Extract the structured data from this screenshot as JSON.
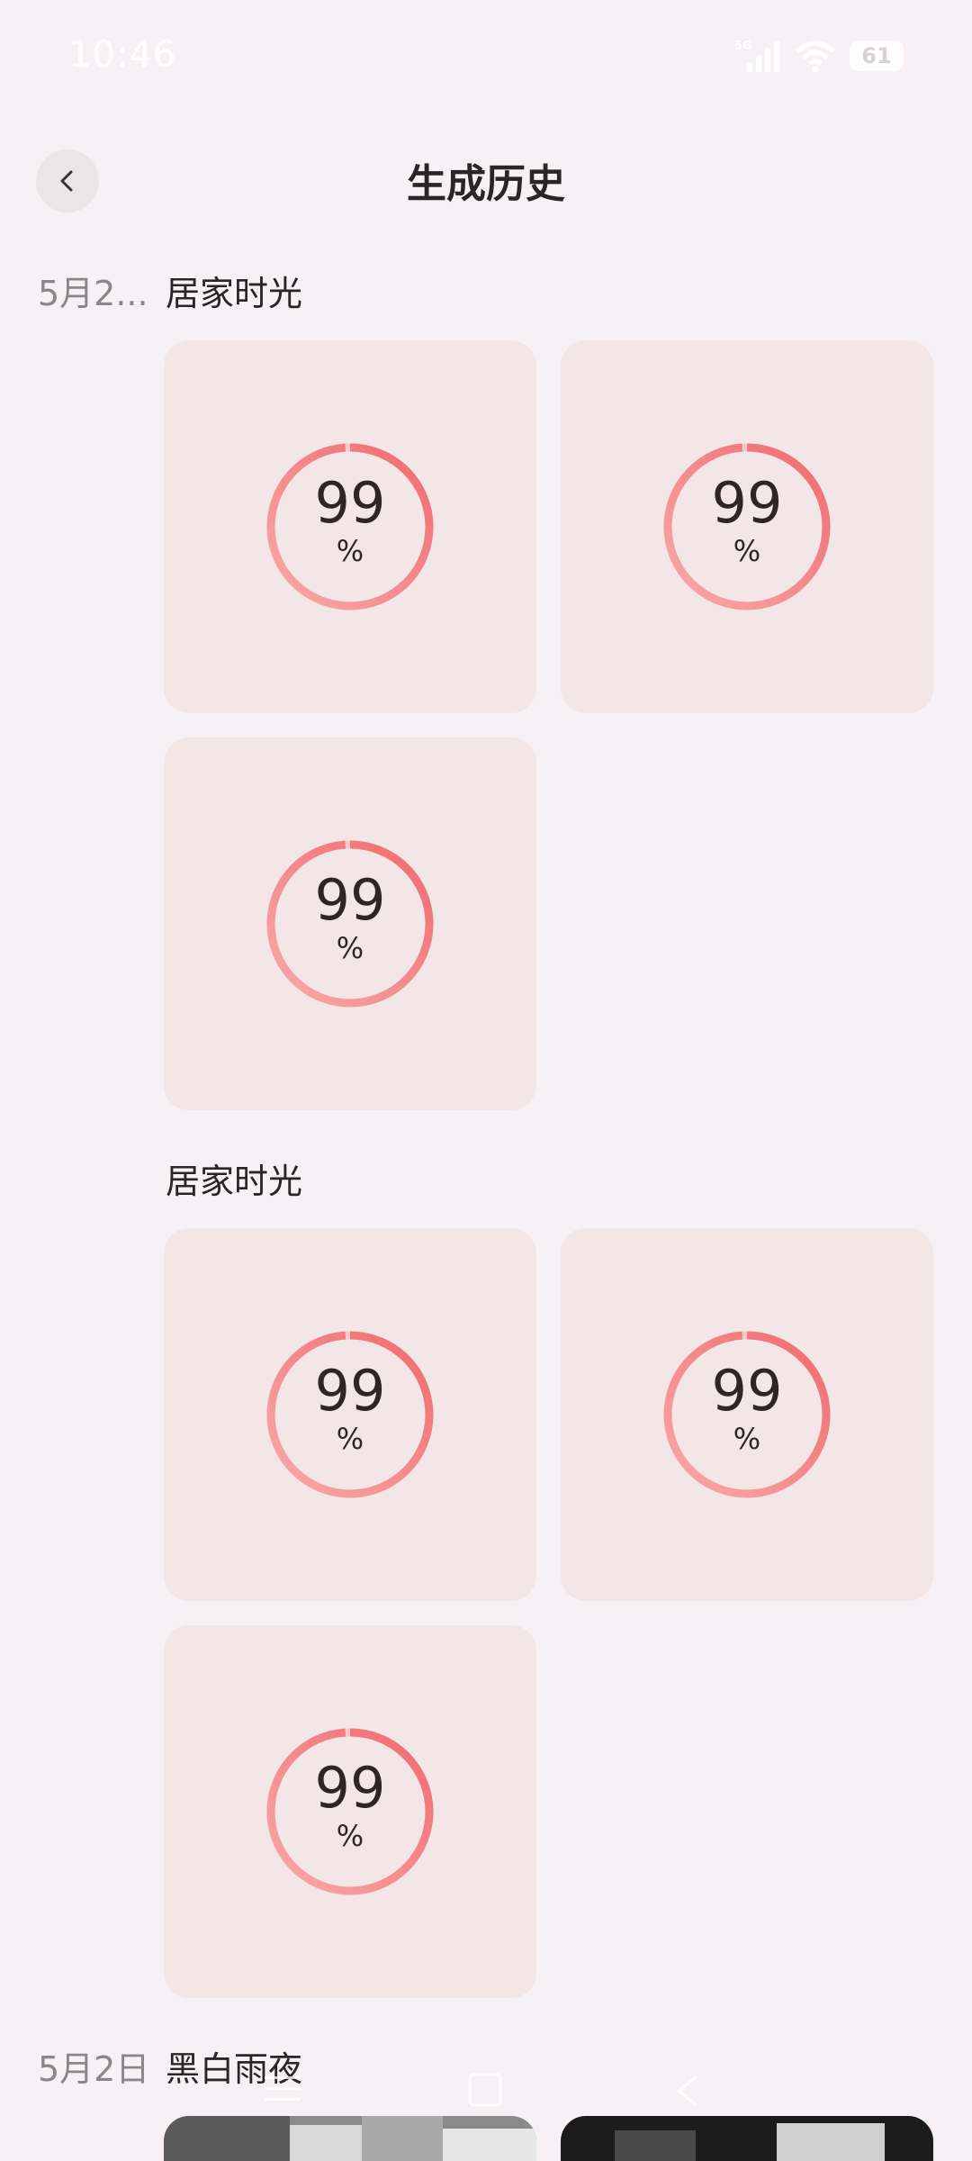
{
  "status_bar": {
    "time": "10:46",
    "network": "5G",
    "battery": "61",
    "icons": [
      "signal-icon",
      "wifi-icon",
      "battery-icon"
    ]
  },
  "header": {
    "title": "生成历史",
    "back_icon": "chevron-left-icon"
  },
  "sections": [
    {
      "date": "5月2...",
      "groups": [
        {
          "title": "居家时光",
          "items": [
            {
              "progress": "99",
              "unit": "%",
              "fraction": 0.99
            },
            {
              "progress": "99",
              "unit": "%",
              "fraction": 0.99
            },
            {
              "progress": "99",
              "unit": "%",
              "fraction": 0.99
            }
          ]
        },
        {
          "title": "居家时光",
          "items": [
            {
              "progress": "99",
              "unit": "%",
              "fraction": 0.99
            },
            {
              "progress": "99",
              "unit": "%",
              "fraction": 0.99
            },
            {
              "progress": "99",
              "unit": "%",
              "fraction": 0.99
            }
          ]
        }
      ]
    },
    {
      "date": "5月2日",
      "groups": [
        {
          "title": "黑白雨夜",
          "items": [
            {
              "type": "photo",
              "tone": "grayscale-light"
            },
            {
              "type": "photo",
              "tone": "grayscale-dark"
            }
          ]
        }
      ]
    }
  ],
  "colors": {
    "background": "#f7f1f5",
    "card": "#f2e6e7",
    "ring_start": "#f9aaaa",
    "ring_end": "#f06a6e"
  },
  "nav_bar": {
    "icons": [
      "menu-icon",
      "home-square-icon",
      "back-triangle-icon"
    ]
  }
}
